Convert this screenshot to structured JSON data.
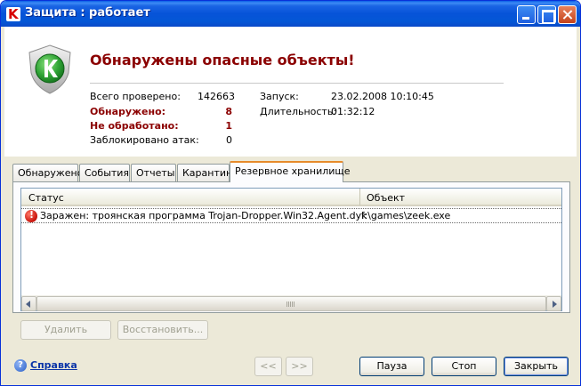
{
  "window": {
    "title": "Защита : работает",
    "logo_letter": "K"
  },
  "header": {
    "headline": "Обнаружены опасные объекты!",
    "stats": {
      "scanned_label": "Всего проверено:",
      "scanned_value": "142663",
      "detected_label": "Обнаружено:",
      "detected_value": "8",
      "unprocessed_label": "Не обработано:",
      "unprocessed_value": "1",
      "blocked_label": "Заблокировано атак:",
      "blocked_value": "0",
      "start_label": "Запуск:",
      "start_value": "23.02.2008 10:10:45",
      "duration_label": "Длительность:",
      "duration_value": "01:32:12"
    }
  },
  "tabs": [
    {
      "label": "Обнаружено"
    },
    {
      "label": "События"
    },
    {
      "label": "Отчеты"
    },
    {
      "label": "Карантин"
    },
    {
      "label": "Резервное хранилище",
      "active": true
    }
  ],
  "table": {
    "columns": [
      "Статус",
      "Объект"
    ],
    "rows": [
      {
        "status": "Заражен: троянская программа Trojan-Dropper.Win32.Agent.dyk",
        "object": "f:\\games\\zeek.exe",
        "icon": "error-icon"
      }
    ]
  },
  "actions": {
    "delete": "Удалить",
    "restore": "Восстановить..."
  },
  "footer": {
    "help": "Справка",
    "prev": "<<",
    "next": ">>",
    "pause": "Пауза",
    "stop": "Стоп",
    "close": "Закрыть"
  },
  "colors": {
    "alert_red": "#8b0000",
    "titlebar_blue": "#0653d8",
    "shield_green": "#2fa335"
  }
}
